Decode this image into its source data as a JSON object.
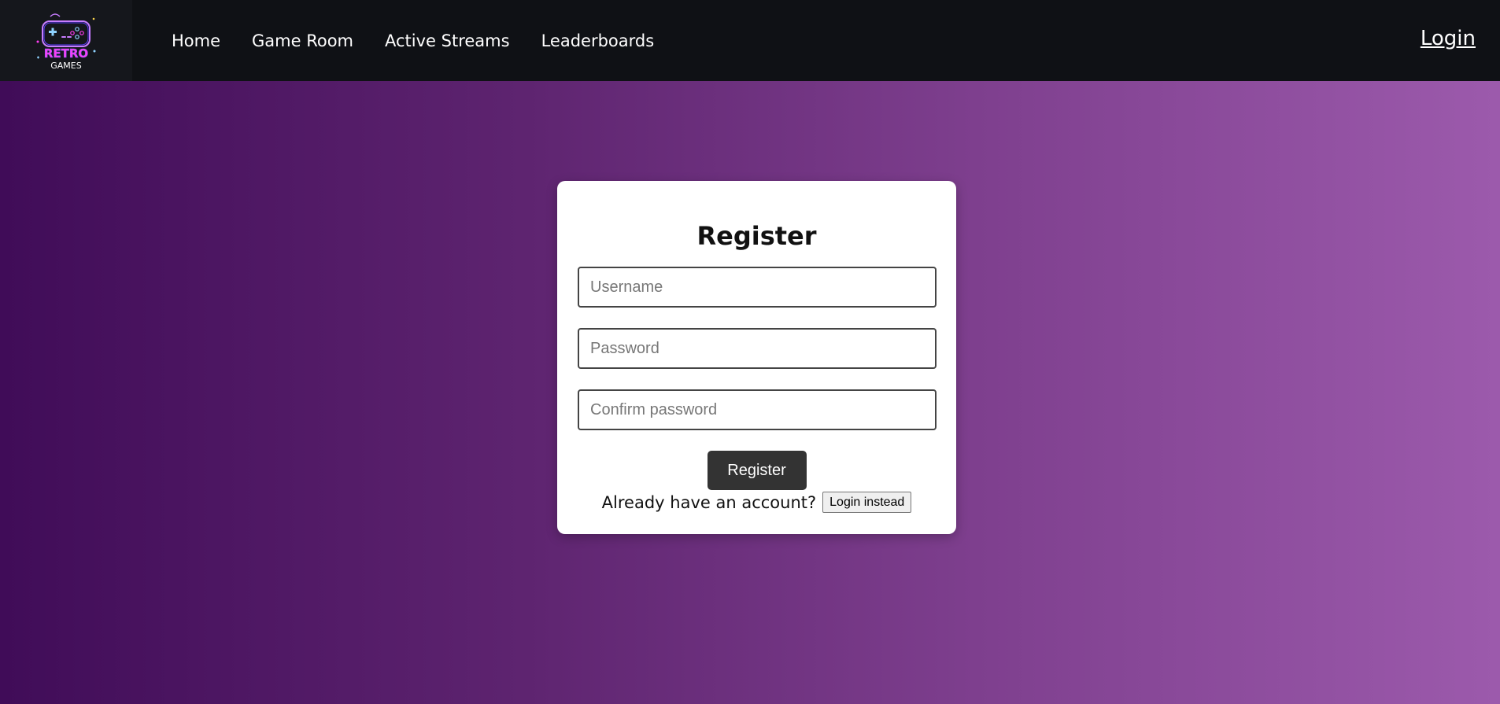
{
  "header": {
    "logo": {
      "icon": "retro-games-neon-gamepad-logo",
      "word1": "RETRO",
      "word2": "GAMES"
    },
    "nav": [
      {
        "label": "Home"
      },
      {
        "label": "Game Room"
      },
      {
        "label": "Active Streams"
      },
      {
        "label": "Leaderboards"
      }
    ],
    "login_label": "Login"
  },
  "register_form": {
    "title": "Register",
    "username_placeholder": "Username",
    "password_placeholder": "Password",
    "confirm_placeholder": "Confirm password",
    "submit_label": "Register",
    "account_prompt": "Already have an account?",
    "login_instead_label": "Login instead"
  },
  "colors": {
    "navbar_bg": "#0f1115",
    "gradient_start": "#400c58",
    "gradient_end": "#9c5aac",
    "submit_bg": "#333333",
    "logo_magenta": "#ff3df2",
    "logo_purple": "#8a5cff"
  }
}
